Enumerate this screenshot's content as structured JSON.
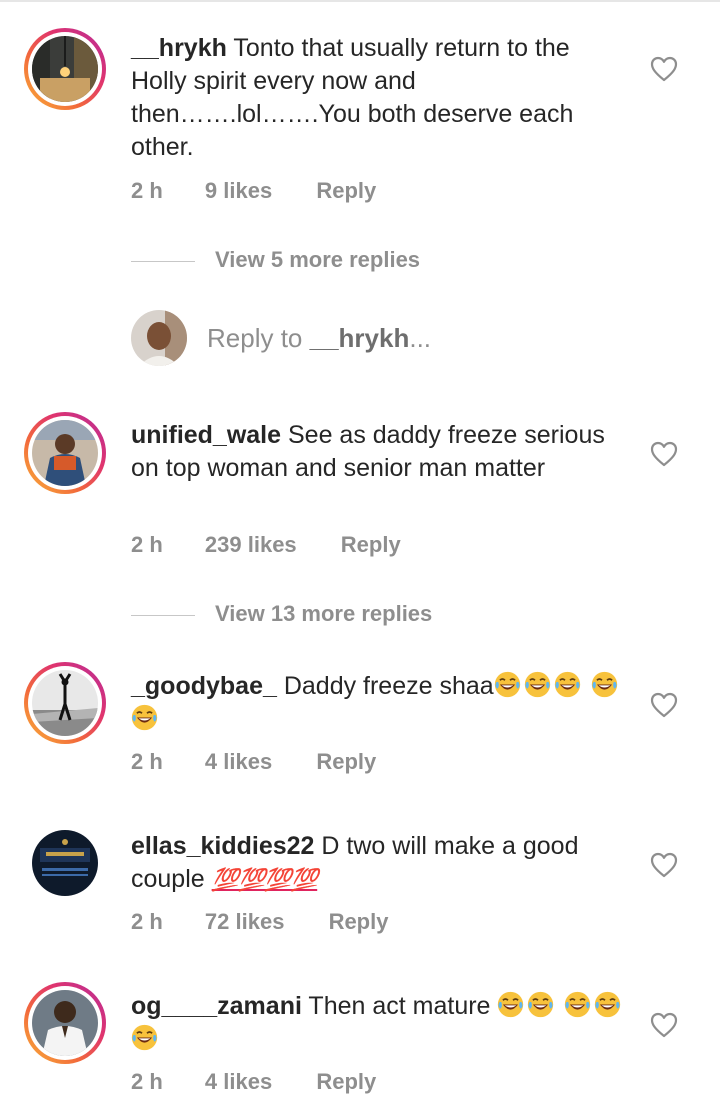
{
  "comments": [
    {
      "username": "__hrykh",
      "text": "Tonto that usually return to the Holly spirit every now and then…….lol…….You both deserve each other.",
      "time": "2 h",
      "likes": "9 likes",
      "reply": "Reply",
      "view_more": "View 5 more replies"
    },
    {
      "username": "unified_wale",
      "text": "See as daddy freeze serious on top woman and senior man matter",
      "time": "2 h",
      "likes": "239 likes",
      "reply": "Reply",
      "view_more": "View 13 more replies"
    },
    {
      "username": "_goodybae_",
      "text": "Daddy freeze shaa",
      "time": "2 h",
      "likes": "4 likes",
      "reply": "Reply"
    },
    {
      "username": "ellas_kiddies22",
      "text": "D two will make a good couple",
      "hundreds": "💯💯💯💯",
      "time": "2 h",
      "likes": "72 likes",
      "reply": "Reply"
    },
    {
      "username": "og____zamani",
      "text": "Then act mature",
      "time": "2 h",
      "likes": "4 likes",
      "reply": "Reply"
    }
  ],
  "reply_to": {
    "prefix": "Reply to",
    "username": "__hrykh",
    "suffix": "..."
  },
  "icons": {
    "like": "heart-outline-icon",
    "emoji": "face-with-tears-of-joy-icon"
  },
  "colors": {
    "text": "#262626",
    "meta": "#8e8e8e",
    "story_ring_start": "#f9b43a",
    "story_ring_end": "#b52c9b"
  }
}
